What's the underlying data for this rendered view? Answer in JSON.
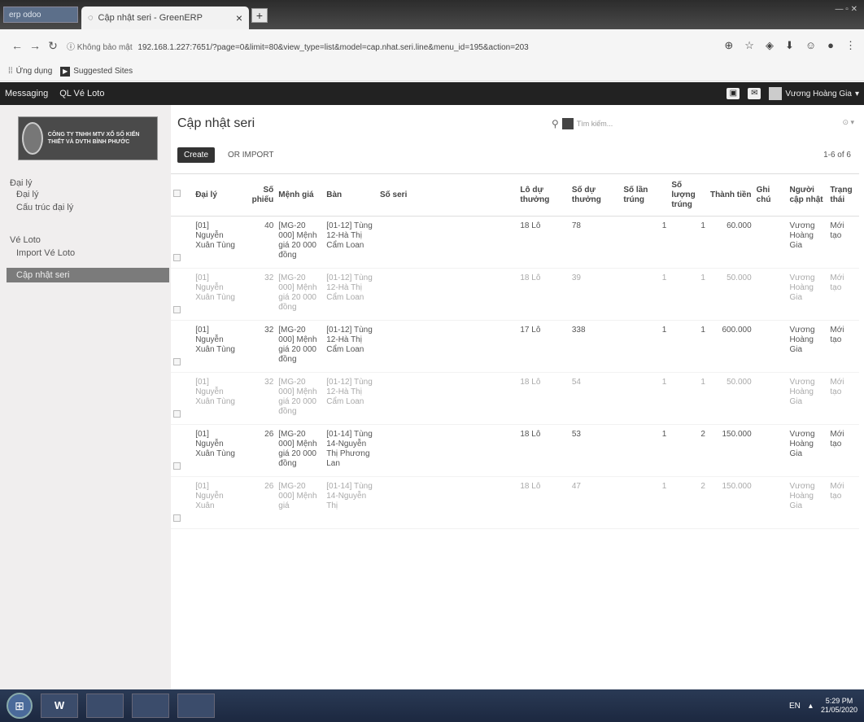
{
  "browser": {
    "window_label": "erp odoo",
    "tab_title": "Cập nhật seri - GreenERP",
    "tab_close": "×",
    "new_tab": "+",
    "security": "Không bảo mật",
    "url": "192.168.1.227:7651/?page=0&limit=80&view_type=list&model=cap.nhat.seri.line&menu_id=195&action=203",
    "bookmarks": [
      {
        "icon": "apps-icon",
        "label": "Ứng dụng"
      },
      {
        "icon": "suggested-sites-icon",
        "label": "Suggested Sites"
      }
    ]
  },
  "app_nav": {
    "menus": [
      "Messaging",
      "QL Vé Loto"
    ],
    "user": "Vương Hoàng Gia"
  },
  "sidebar": {
    "logo_text": "CÔNG TY TNHH MTV XỔ SỐ KIẾN THIẾT VÀ DVTH BÌNH PHƯỚC",
    "sections": [
      {
        "title": "Đại lý",
        "items": [
          "Đại lý",
          "Cấu trúc đại lý"
        ]
      },
      {
        "title": "Vé Loto",
        "items": [
          "Import Vé Loto",
          "Cập nhật seri"
        ]
      }
    ],
    "active_item": "Cập nhật seri"
  },
  "main": {
    "title": "Cập nhật seri",
    "search_placeholder": "Tìm kiếm...",
    "create_label": "Create",
    "import_label": "or Import",
    "pager": "1-6 of 6",
    "columns": [
      "Đại lý",
      "Số phiếu",
      "Mệnh giá",
      "Bàn",
      "Số seri",
      "Lô dự thưởng",
      "Số dự thưởng",
      "Số lần trúng",
      "Số lượng trúng",
      "Thành tiền",
      "Ghi chú",
      "Người cập nhật",
      "Trạng thái"
    ],
    "rows": [
      {
        "dai_ly": "[01] Nguyễn Xuân Tùng",
        "so_phieu": "40",
        "menh_gia": "[MG-20 000] Mệnh giá 20 000 đồng",
        "ban": "[01-12] Tùng 12-Hà Thị Cẩm Loan",
        "so_seri": "",
        "lo": "18 Lô",
        "so_du": "78",
        "lan_trung": "1",
        "sl_trung": "1",
        "thanh_tien": "60.000",
        "ghi_chu": "",
        "nguoi": "Vương Hoàng Gia",
        "trang_thai": "Mới tạo"
      },
      {
        "dai_ly": "[01] Nguyễn Xuân Tùng",
        "so_phieu": "32",
        "menh_gia": "[MG-20 000] Mệnh giá 20 000 đồng",
        "ban": "[01-12] Tùng 12-Hà Thị Cẩm Loan",
        "so_seri": "",
        "lo": "18 Lô",
        "so_du": "39",
        "lan_trung": "1",
        "sl_trung": "1",
        "thanh_tien": "50.000",
        "ghi_chu": "",
        "nguoi": "Vương Hoàng Gia",
        "trang_thai": "Mới tạo"
      },
      {
        "dai_ly": "[01] Nguyễn Xuân Tùng",
        "so_phieu": "32",
        "menh_gia": "[MG-20 000] Mệnh giá 20 000 đồng",
        "ban": "[01-12] Tùng 12-Hà Thị Cẩm Loan",
        "so_seri": "",
        "lo": "17 Lô",
        "so_du": "338",
        "lan_trung": "1",
        "sl_trung": "1",
        "thanh_tien": "600.000",
        "ghi_chu": "",
        "nguoi": "Vương Hoàng Gia",
        "trang_thai": "Mới tạo"
      },
      {
        "dai_ly": "[01] Nguyễn Xuân Tùng",
        "so_phieu": "32",
        "menh_gia": "[MG-20 000] Mệnh giá 20 000 đồng",
        "ban": "[01-12] Tùng 12-Hà Thị Cẩm Loan",
        "so_seri": "",
        "lo": "18 Lô",
        "so_du": "54",
        "lan_trung": "1",
        "sl_trung": "1",
        "thanh_tien": "50.000",
        "ghi_chu": "",
        "nguoi": "Vương Hoàng Gia",
        "trang_thai": "Mới tạo"
      },
      {
        "dai_ly": "[01] Nguyễn Xuân Tùng",
        "so_phieu": "26",
        "menh_gia": "[MG-20 000] Mệnh giá 20 000 đồng",
        "ban": "[01-14] Tùng 14-Nguyễn Thị Phương Lan",
        "so_seri": "",
        "lo": "18 Lô",
        "so_du": "53",
        "lan_trung": "1",
        "sl_trung": "2",
        "thanh_tien": "150.000",
        "ghi_chu": "",
        "nguoi": "Vương Hoàng Gia",
        "trang_thai": "Mới tạo"
      },
      {
        "dai_ly": "[01] Nguyễn Xuân",
        "so_phieu": "26",
        "menh_gia": "[MG-20 000] Mệnh giá",
        "ban": "[01-14] Tùng 14-Nguyễn Thị",
        "so_seri": "",
        "lo": "18 Lô",
        "so_du": "47",
        "lan_trung": "1",
        "sl_trung": "2",
        "thanh_tien": "150.000",
        "ghi_chu": "",
        "nguoi": "Vương Hoàng Gia",
        "trang_thai": "Mới tạo"
      }
    ]
  },
  "taskbar": {
    "app_label": "W",
    "lang": "EN",
    "time": "5:29 PM",
    "date": "21/05/2020"
  }
}
